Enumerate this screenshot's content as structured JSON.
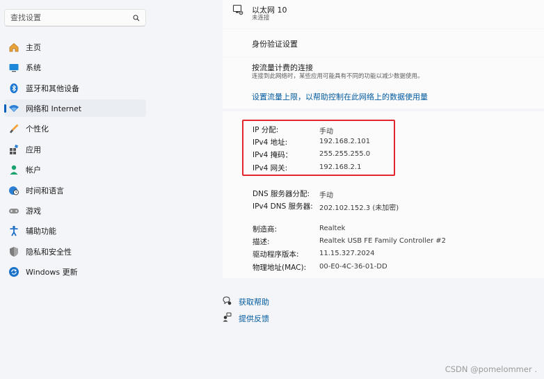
{
  "search": {
    "placeholder": "查找设置"
  },
  "sidebar": {
    "items": [
      {
        "label": "主页",
        "icon": "home-icon"
      },
      {
        "label": "系统",
        "icon": "system-icon"
      },
      {
        "label": "蓝牙和其他设备",
        "icon": "bluetooth-icon"
      },
      {
        "label": "网络和 Internet",
        "icon": "network-icon",
        "active": true
      },
      {
        "label": "个性化",
        "icon": "brush-icon"
      },
      {
        "label": "应用",
        "icon": "apps-icon"
      },
      {
        "label": "帐户",
        "icon": "account-icon"
      },
      {
        "label": "时间和语言",
        "icon": "globe-clock-icon"
      },
      {
        "label": "游戏",
        "icon": "gamepad-icon"
      },
      {
        "label": "辅助功能",
        "icon": "accessibility-icon"
      },
      {
        "label": "隐私和安全性",
        "icon": "shield-icon"
      },
      {
        "label": "Windows 更新",
        "icon": "update-icon"
      }
    ]
  },
  "adapter": {
    "name": "以太网 10",
    "status": "未连接"
  },
  "auth": {
    "label": "身份验证设置"
  },
  "metered": {
    "title": "按流量计费的连接",
    "desc": "连接到此网络时，某些应用可能具有不同的功能以减少数据使用。",
    "link": "设置流量上限，以帮助控制在此网络上的数据使用量"
  },
  "ip": {
    "assign_label": "IP 分配:",
    "assign_value": "手动",
    "ipv4_label": "IPv4 地址:",
    "ipv4_value": "192.168.2.101",
    "mask_label": "IPv4 掩码：",
    "mask_value": "255.255.255.0",
    "gateway_label": "IPv4 网关:",
    "gateway_value": "192.168.2.1"
  },
  "dns": {
    "assign_label": "DNS 服务器分配:",
    "assign_value": "手动",
    "server_label": "IPv4 DNS 服务器:",
    "server_value": "202.102.152.3 (未加密)"
  },
  "hw": {
    "maker_label": "制造商:",
    "maker_value": "Realtek",
    "desc_label": "描述:",
    "desc_value": "Realtek USB FE Family Controller #2",
    "driver_label": "驱动程序版本:",
    "driver_value": "11.15.327.2024",
    "mac_label": "物理地址(MAC):",
    "mac_value": "00-E0-4C-36-01-DD"
  },
  "footer": {
    "help": "获取帮助",
    "feedback": "提供反馈"
  },
  "watermark": "CSDN @pomelommer .",
  "colors": {
    "accent": "#005fb8",
    "highlight_box": "#e3262e"
  }
}
